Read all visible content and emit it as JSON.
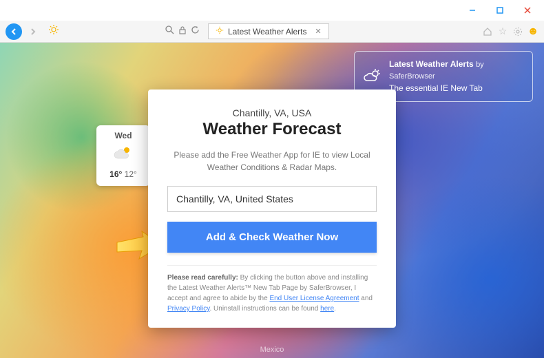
{
  "window": {
    "tab_title": "Latest Weather Alerts"
  },
  "banner": {
    "title": "Latest Weather Alerts",
    "by": "by SaferBrowser",
    "subtitle": "The essential IE New Tab"
  },
  "day_tile": {
    "day": "Wed",
    "high": "16°",
    "low": "12°"
  },
  "card": {
    "location": "Chantilly, VA, USA",
    "heading": "Weather Forecast",
    "blurb": "Please add the Free Weather App for IE to view Local Weather Conditions & Radar Maps.",
    "input_value": "Chantilly, VA, United States",
    "cta_label": "Add & Check Weather Now",
    "legal_lead": "Please read carefully:",
    "legal_text_1": " By clicking the button above and installing the Latest Weather Alerts™ New Tab Page by SaferBrowser, I accept and agree to abide by the ",
    "eula": "End User License Agreement",
    "legal_and": " and ",
    "privacy": "Privacy Policy",
    "legal_text_2": ". Uninstall instructions can be found ",
    "here": "here",
    "period": "."
  },
  "map": {
    "mexico": "Mexico"
  }
}
